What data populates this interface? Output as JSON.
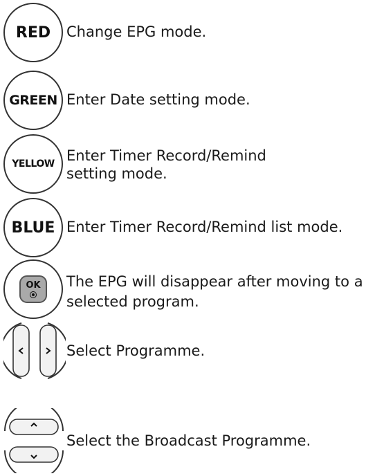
{
  "items": [
    {
      "button": "RED",
      "text": "Change EPG mode."
    },
    {
      "button": "GREEN",
      "text": "Enter Date setting mode."
    },
    {
      "button": "YELLOW",
      "text": "Enter Timer Record/Remind setting mode."
    },
    {
      "button": "BLUE",
      "text": "Enter Timer Record/Remind list mode."
    },
    {
      "button": "OK",
      "text": "The EPG will disappear after moving to a selected program."
    },
    {
      "button": "",
      "text": "Select Programme."
    },
    {
      "button": "",
      "text": "Select the Broadcast Programme."
    }
  ]
}
